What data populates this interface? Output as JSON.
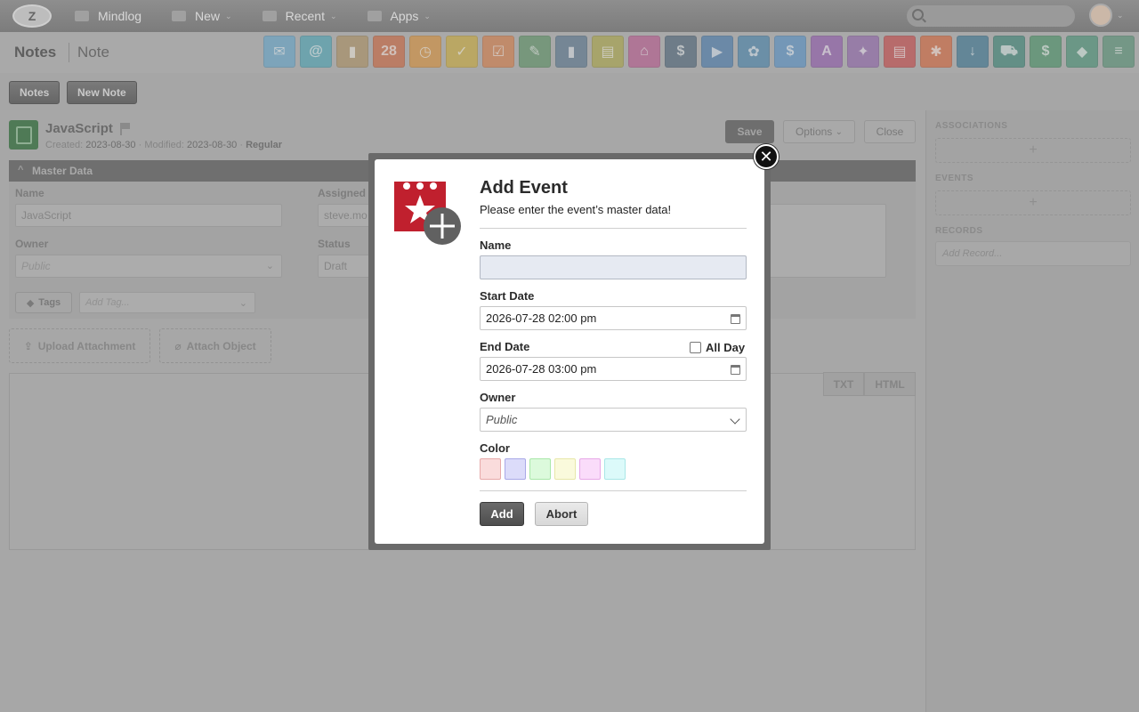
{
  "topbar": {
    "logo_letter": "Z",
    "nav": [
      {
        "label": "Mindlog",
        "has_chevron": false
      },
      {
        "label": "New",
        "has_chevron": true
      },
      {
        "label": "Recent",
        "has_chevron": true
      },
      {
        "label": "Apps",
        "has_chevron": true
      }
    ],
    "chevron": "⌄"
  },
  "header": {
    "crumb_primary": "Notes",
    "crumb_secondary": "Note",
    "apps": [
      {
        "icon": "mail-icon",
        "color": "#5aa0c8",
        "glyph": "✉"
      },
      {
        "icon": "address-book-icon",
        "color": "#3f9fb2",
        "glyph": "@"
      },
      {
        "icon": "contacts-icon",
        "color": "#a88a56",
        "glyph": "▮"
      },
      {
        "icon": "calendar-icon",
        "color": "#c85a2e",
        "glyph": "28"
      },
      {
        "icon": "timer-icon",
        "color": "#d88a2a",
        "glyph": "◷"
      },
      {
        "icon": "tasks-icon",
        "color": "#c9a62c",
        "glyph": "✓"
      },
      {
        "icon": "todo-icon",
        "color": "#d4743a",
        "glyph": "☑"
      },
      {
        "icon": "notes-icon",
        "color": "#4f8a58",
        "glyph": "✎"
      },
      {
        "icon": "bookmark-icon",
        "color": "#4b6b86",
        "glyph": "▮"
      },
      {
        "icon": "document-icon",
        "color": "#a6a03a",
        "glyph": "▤"
      },
      {
        "icon": "desk-icon",
        "color": "#b44e88",
        "glyph": "⌂"
      },
      {
        "icon": "finance-icon",
        "color": "#3e586e",
        "glyph": "$"
      },
      {
        "icon": "delivery-icon",
        "color": "#3a70a6",
        "glyph": "▶"
      },
      {
        "icon": "support-icon",
        "color": "#3a7aa6",
        "glyph": "✿"
      },
      {
        "icon": "moneybag-icon",
        "color": "#4a8ac4",
        "glyph": "$"
      },
      {
        "icon": "signature-icon",
        "color": "#8a4ea8",
        "glyph": "A"
      },
      {
        "icon": "handshake-icon",
        "color": "#8a5aa6",
        "glyph": "✦"
      },
      {
        "icon": "invoice-icon",
        "color": "#c43a3a",
        "glyph": "▤"
      },
      {
        "icon": "broadcast-icon",
        "color": "#d45a2a",
        "glyph": "✱"
      },
      {
        "icon": "download-icon",
        "color": "#2a6a8a",
        "glyph": "↓"
      },
      {
        "icon": "shopping-cart-icon",
        "color": "#2a7a6a",
        "glyph": "⛟"
      },
      {
        "icon": "cash-icon",
        "color": "#3a8a5a",
        "glyph": "$"
      },
      {
        "icon": "tag-icon",
        "color": "#3a8a6a",
        "glyph": "◆"
      },
      {
        "icon": "database-icon",
        "color": "#4a8a6a",
        "glyph": "≡"
      }
    ]
  },
  "toolbar": {
    "notes_label": "Notes",
    "new_note_label": "New Note"
  },
  "note": {
    "title": "JavaScript",
    "created_label": "Created:",
    "created": "2023-08-30",
    "modified_label": "· Modified:",
    "modified": "2023-08-30",
    "type_sep": "·",
    "type": "Regular",
    "save_label": "Save",
    "options_label": "Options",
    "close_label": "Close",
    "section_label": "Master Data",
    "fields": {
      "name_label": "Name",
      "name_value": "JavaScript",
      "assigned_label": "Assigned t",
      "assigned_value": "steve.mo",
      "owner_label": "Owner",
      "owner_value": "Public",
      "status_label": "Status",
      "status_value": "Draft"
    },
    "tags_label": "Tags",
    "add_tag_placeholder": "Add Tag...",
    "upload_label": "Upload Attachment",
    "attach_label": "Attach Object",
    "txt_label": "TXT",
    "html_label": "HTML"
  },
  "sidebar": {
    "associations_label": "ASSOCIATIONS",
    "events_label": "EVENTS",
    "records_label": "RECORDS",
    "add_glyph": "+",
    "add_record_placeholder": "Add Record..."
  },
  "modal": {
    "close_glyph": "✕",
    "title": "Add Event",
    "subtitle": "Please enter the event’s master data!",
    "name_label": "Name",
    "name_value": "",
    "start_label": "Start Date",
    "start_value": "2026-07-28 02:00 pm",
    "end_label": "End Date",
    "end_value": "2026-07-28 03:00 pm",
    "allday_label": "All Day",
    "allday_checked": false,
    "owner_label": "Owner",
    "owner_value": "Public",
    "color_label": "Color",
    "colors": [
      {
        "bg": "#fadcdc",
        "border": "#e7a9a9"
      },
      {
        "bg": "#dcdcfa",
        "border": "#a9a9e7"
      },
      {
        "bg": "#dcfadc",
        "border": "#a9e7a9"
      },
      {
        "bg": "#fafadc",
        "border": "#e7e7a9"
      },
      {
        "bg": "#fadcfa",
        "border": "#e7a9e7"
      },
      {
        "bg": "#dcfafa",
        "border": "#a9e7e7"
      }
    ],
    "add_label": "Add",
    "abort_label": "Abort"
  }
}
